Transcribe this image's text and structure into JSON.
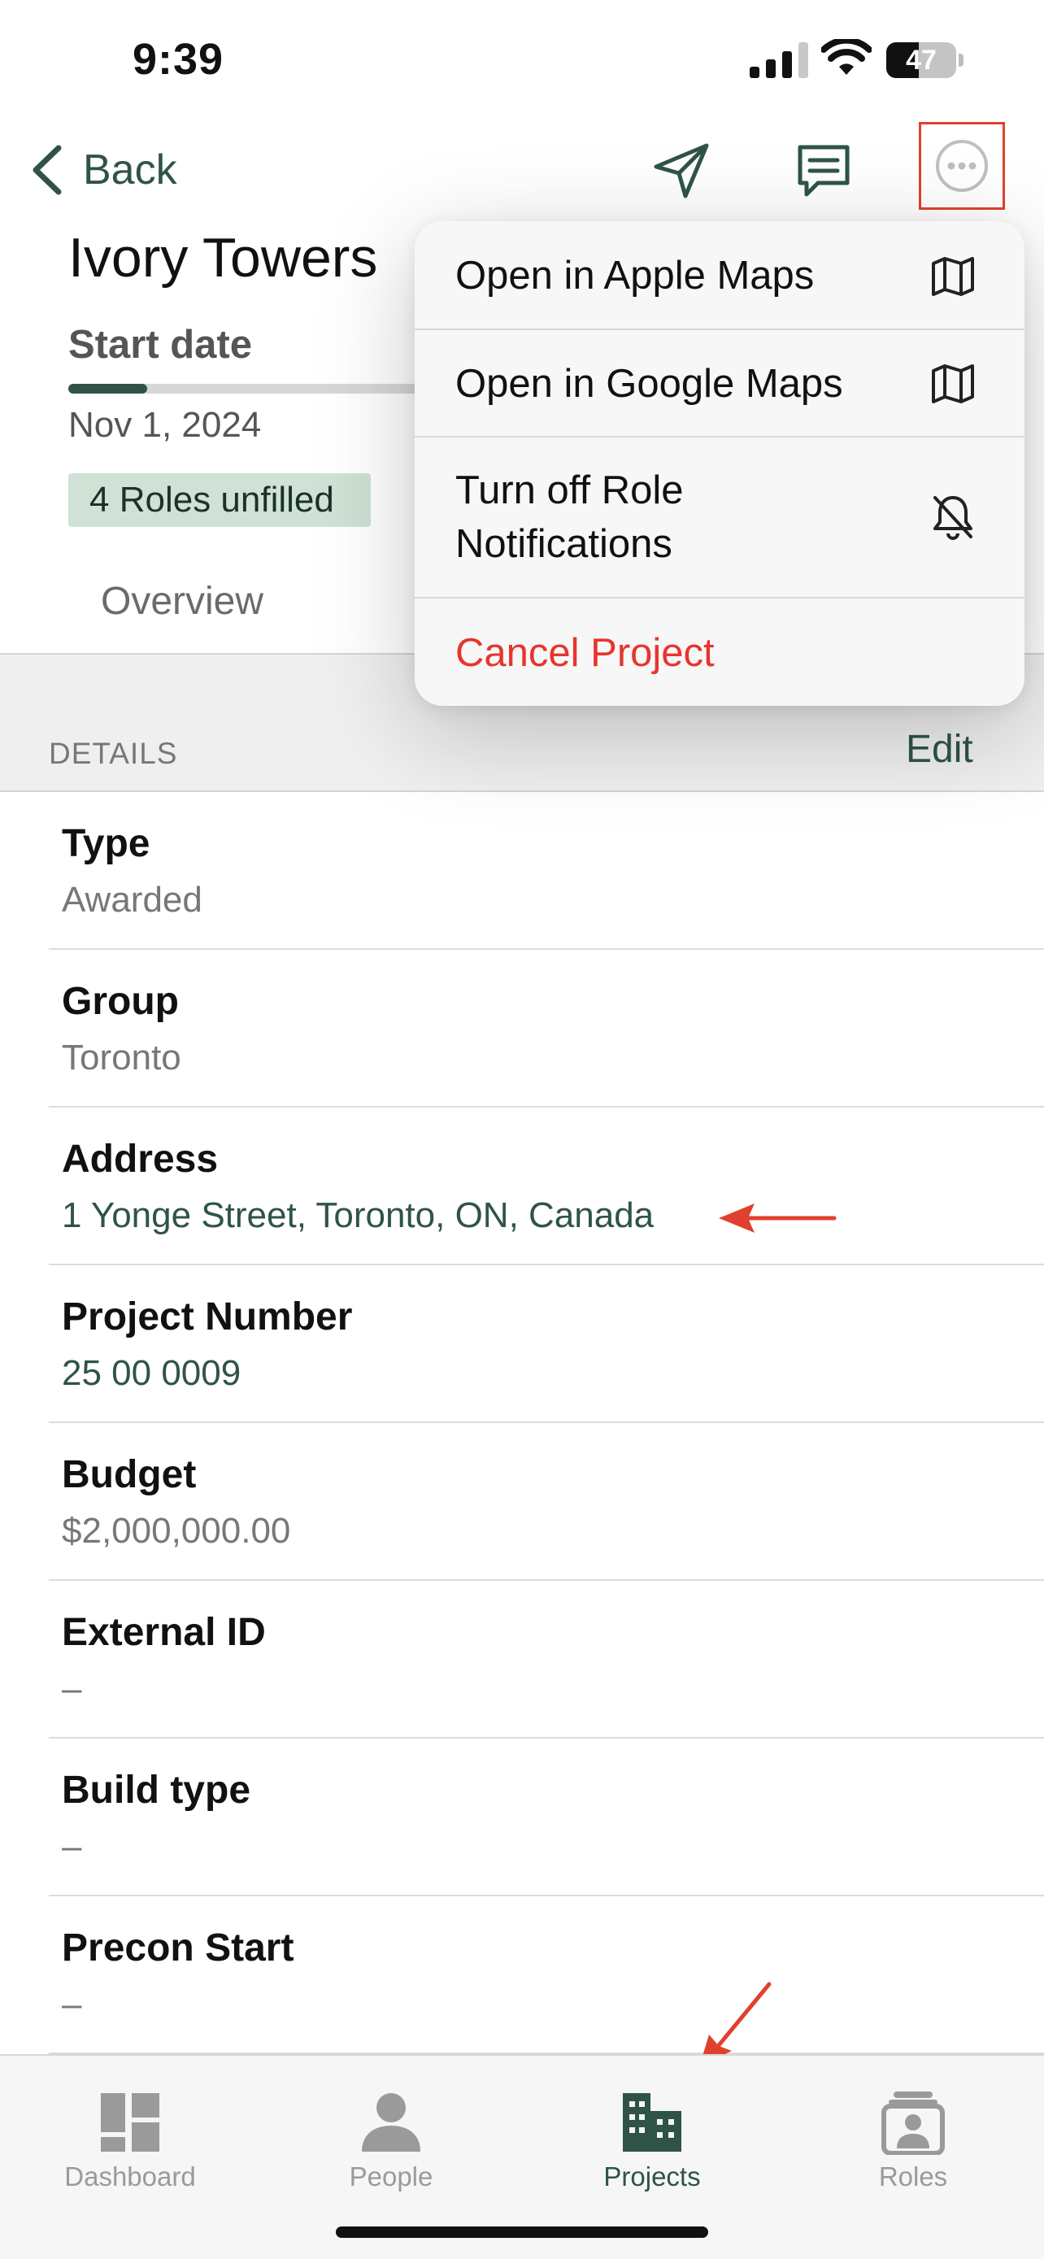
{
  "status_bar": {
    "time": "9:39",
    "battery": "47",
    "battery_level": 0.47
  },
  "nav": {
    "back_label": "Back"
  },
  "project": {
    "title": "Ivory Towers",
    "start_label": "Start date",
    "start_date": "Nov 1, 2024",
    "progress": 0.21,
    "roles_badge": "4 Roles unfilled"
  },
  "tabs": {
    "overview": "Overview"
  },
  "details": {
    "section_label": "DETAILS",
    "edit_label": "Edit",
    "fields": [
      {
        "label": "Type",
        "value": "Awarded"
      },
      {
        "label": "Group",
        "value": "Toronto"
      },
      {
        "label": "Address",
        "value": "1 Yonge Street, Toronto, ON, Canada"
      },
      {
        "label": "Project Number",
        "value": "25 00 0009"
      },
      {
        "label": "Budget",
        "value": "$2,000,000.00"
      },
      {
        "label": "External ID",
        "value": "–"
      },
      {
        "label": "Build type",
        "value": "–"
      },
      {
        "label": "Precon Start",
        "value": "–"
      }
    ]
  },
  "menu": {
    "items": [
      {
        "label": "Open in Apple Maps",
        "icon": "map-icon"
      },
      {
        "label": "Open in Google Maps",
        "icon": "map-icon"
      },
      {
        "label": "Turn off Role\nNotifications",
        "icon": "bell-slash-icon"
      },
      {
        "label": "Cancel Project",
        "icon": ""
      }
    ]
  },
  "tab_bar": {
    "items": [
      {
        "label": "Dashboard",
        "icon": "dashboard-icon"
      },
      {
        "label": "People",
        "icon": "person-icon"
      },
      {
        "label": "Projects",
        "icon": "building-icon"
      },
      {
        "label": "Roles",
        "icon": "roles-icon"
      }
    ],
    "active": "Projects"
  },
  "colors": {
    "accent": "#2f5446",
    "danger": "#e8342e",
    "annotation": "#e2402e",
    "badge_bg": "#cfe2d5"
  }
}
